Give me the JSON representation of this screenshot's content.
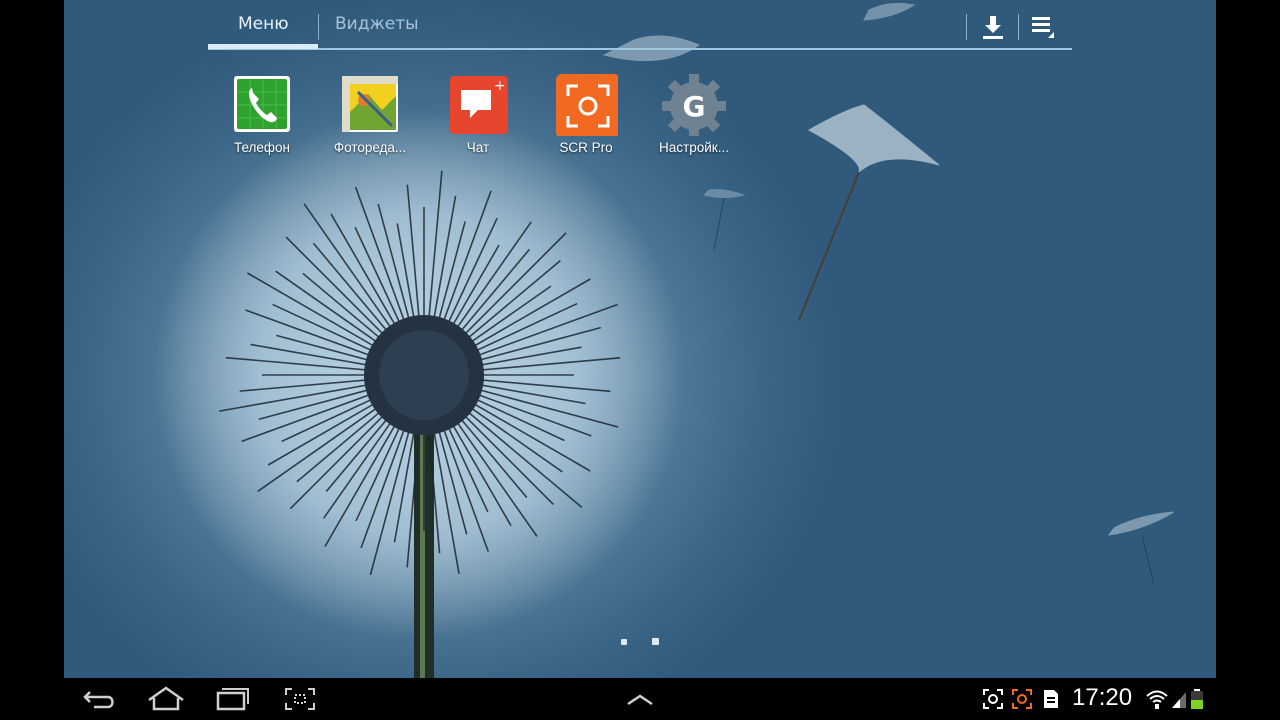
{
  "tabs": [
    {
      "label": "Меню",
      "active": true
    },
    {
      "label": "Виджеты",
      "active": false
    }
  ],
  "top_actions": {
    "download_icon": "download-icon",
    "menu_icon": "overflow-menu-icon"
  },
  "apps": [
    {
      "label": "Телефон",
      "icon": "phone-icon",
      "color": "#2ea12e"
    },
    {
      "label": "Фоторедa...",
      "icon": "photo-editor-icon",
      "color": "#f2d020"
    },
    {
      "label": "Чат",
      "icon": "chat-icon",
      "color": "#e8452f"
    },
    {
      "label": "SCR Pro",
      "icon": "screen-recorder-icon",
      "color": "#f26a21"
    },
    {
      "label": "Настройк...",
      "icon": "google-settings-icon",
      "color": "#6f8292"
    }
  ],
  "page_indicator": {
    "pages": 2,
    "current": 2
  },
  "navigation": {
    "back_icon": "back-icon",
    "home_icon": "home-icon",
    "recent_icon": "recent-apps-icon",
    "screenshot_icon": "screenshot-icon",
    "up_icon": "chevron-up-icon"
  },
  "status": {
    "time": "17:20",
    "icons": [
      "screen-capture-icon",
      "screen-recorder-status-icon",
      "sd-card-icon",
      "wifi-icon",
      "signal-icon",
      "battery-icon"
    ]
  }
}
